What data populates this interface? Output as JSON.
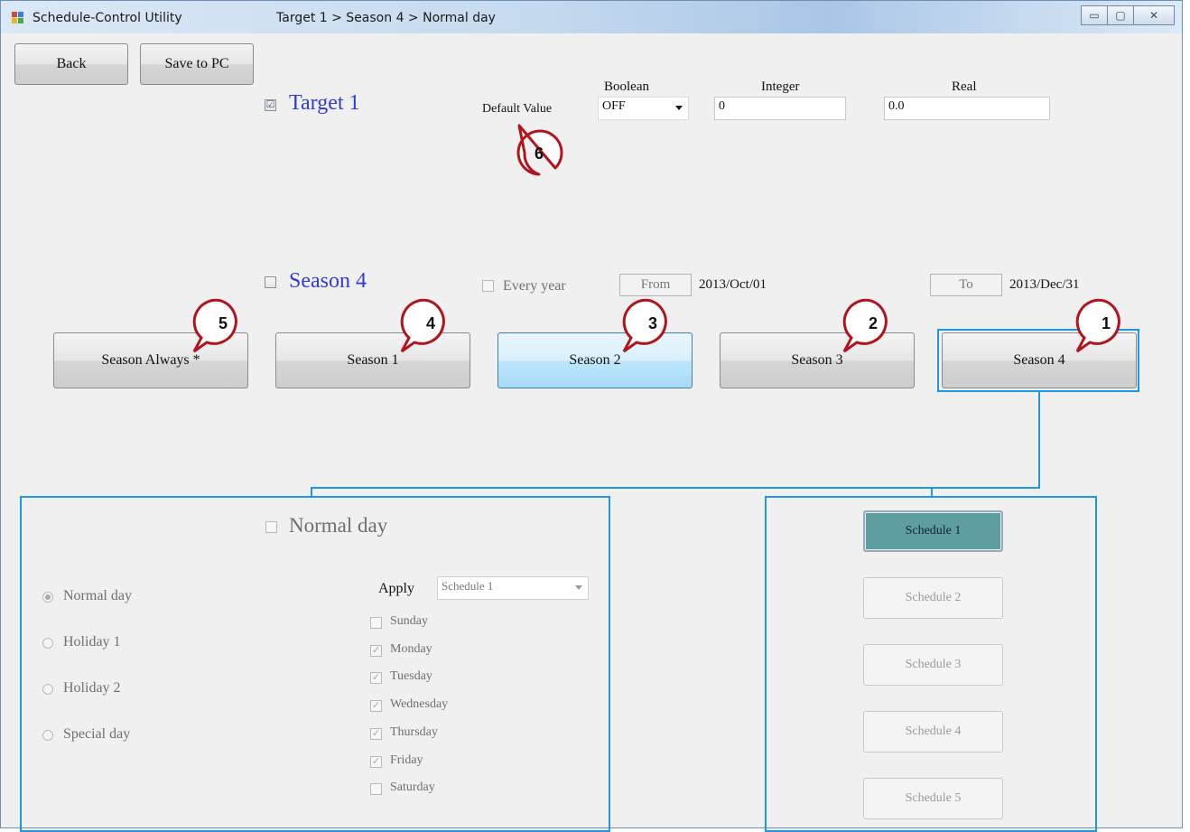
{
  "window": {
    "title": "Schedule-Control Utility",
    "breadcrumb": "Target 1 > Season 4 > Normal day",
    "controls": {
      "minimize": "▭",
      "maximize": "▢",
      "close": "✕"
    }
  },
  "toolbar": {
    "back_label": "Back",
    "save_label": "Save to PC"
  },
  "target": {
    "label": "Target 1",
    "checked": "☑",
    "default_value_label": "Default Value",
    "boolean_label": "Boolean",
    "boolean_value": "OFF",
    "integer_label": "Integer",
    "integer_value": "0",
    "real_label": "Real",
    "real_value": "0.0"
  },
  "season": {
    "label": "Season 4",
    "every_year_label": "Every year",
    "from_label": "From",
    "from_date": "2013/Oct/01",
    "to_label": "To",
    "to_date": "2013/Dec/31"
  },
  "season_buttons": [
    {
      "label": "Season Always *"
    },
    {
      "label": "Season 1"
    },
    {
      "label": "Season 2"
    },
    {
      "label": "Season 3"
    },
    {
      "label": "Season 4"
    }
  ],
  "callouts": [
    "1",
    "2",
    "3",
    "4",
    "5",
    "6"
  ],
  "day_panel": {
    "title": "Normal day",
    "radios": [
      "Normal day",
      "Holiday 1",
      "Holiday 2",
      "Special day"
    ],
    "apply_label": "Apply",
    "apply_value": "Schedule 1",
    "days": [
      {
        "label": "Sunday",
        "mark": ""
      },
      {
        "label": "Monday",
        "mark": "✓"
      },
      {
        "label": "Tuesday",
        "mark": "✓"
      },
      {
        "label": "Wednesday",
        "mark": "✓"
      },
      {
        "label": "Thursday",
        "mark": "✓"
      },
      {
        "label": "Friday",
        "mark": "✓"
      },
      {
        "label": "Saturday",
        "mark": ""
      }
    ]
  },
  "schedules": [
    "Schedule 1",
    "Schedule 2",
    "Schedule 3",
    "Schedule 4",
    "Schedule 5"
  ],
  "colors": {
    "accent_blue": "#1e98e6",
    "callout_red": "#b3131b",
    "active_schedule": "#5f9ea0",
    "target_label_blue": "#2f3bd6"
  }
}
